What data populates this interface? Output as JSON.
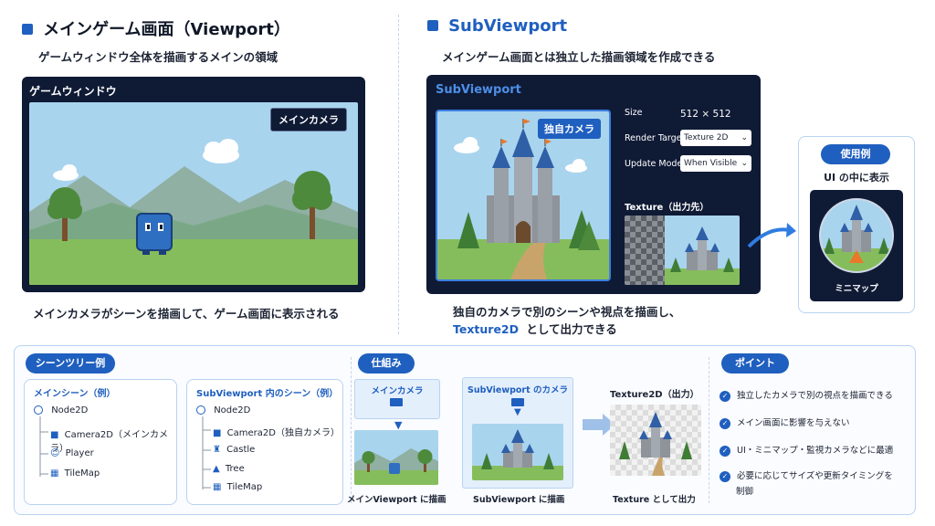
{
  "left": {
    "heading": "メインゲーム画面（Viewport）",
    "subtitle": "ゲームウィンドウ全体を描画するメインの領域",
    "window_title": "ゲームウィンドウ",
    "camera_label": "メインカメラ",
    "caption": "メインカメラがシーンを描画して、ゲーム画面に表示される"
  },
  "right": {
    "heading": "SubViewport",
    "subtitle": "メインゲーム画面とは独立した描画領域を作成できる",
    "window_title": "SubViewport",
    "camera_label": "独自カメラ",
    "size_label": "Size",
    "size_value": "512 × 512",
    "render_target_label": "Render Target",
    "render_target_value": "Texture 2D",
    "update_mode_label": "Update Mode",
    "update_mode_value": "When Visible",
    "texture_label": "Texture（出力先）",
    "caption_line1": "独自のカメラで別のシーンや視点を描画し、",
    "caption_highlight": "Texture2D",
    "caption_line2": "として出力できる"
  },
  "usage": {
    "badge": "使用例",
    "title": "UI の中に表示",
    "minimap_label": "ミニマップ"
  },
  "scene_tree": {
    "badge": "シーンツリー例",
    "main_title": "メインシーン（例）",
    "main_items": [
      "Node2D",
      "Camera2D（メインカメラ）",
      "Player",
      "TileMap"
    ],
    "sub_title": "SubViewport 内のシーン（例）",
    "sub_items": [
      "Node2D",
      "Camera2D（独自カメラ）",
      "Castle",
      "Tree",
      "TileMap"
    ]
  },
  "mechanism": {
    "badge": "仕組み",
    "main_camera": "メインカメラ",
    "sub_camera": "SubViewport のカメラ",
    "texture_title": "Texture2D（出力）",
    "main_caption": "メインViewport に描画",
    "sub_caption": "SubViewport に描画",
    "texture_caption": "Texture として出力"
  },
  "points": {
    "badge": "ポイント",
    "items": [
      "独立したカメラで別の視点を描画できる",
      "メイン画面に影響を与えない",
      "UI・ミニマップ・監視カメラなどに最適",
      "必要に応じてサイズや更新タイミングを",
      "制御"
    ]
  },
  "colors": {
    "accent": "#1f5fbf",
    "dark_window": "#0f1a35",
    "panel_border": "#b9d3f2"
  }
}
